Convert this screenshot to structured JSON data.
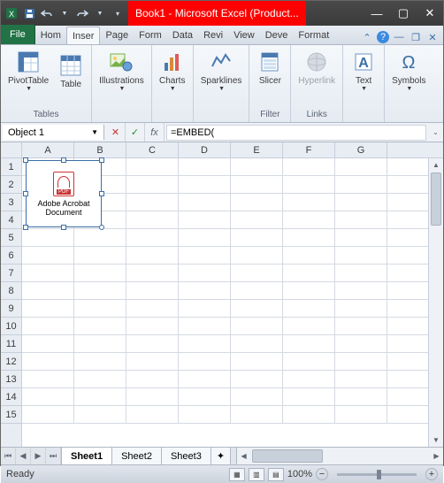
{
  "titlebar": {
    "title": "Book1 - Microsoft Excel (Product...",
    "qat": {
      "save": "save",
      "undo": "undo",
      "redo": "redo"
    }
  },
  "tabs": {
    "file": "File",
    "items": [
      "Hom",
      "Inser",
      "Page",
      "Form",
      "Data",
      "Revi",
      "View",
      "Deve",
      "Format"
    ],
    "active_index": 1
  },
  "ribbon": {
    "groups": [
      {
        "label": "Tables",
        "buttons": [
          {
            "name": "pivottable",
            "label": "PivotTable",
            "dd": true
          },
          {
            "name": "table",
            "label": "Table"
          }
        ]
      },
      {
        "label": "",
        "buttons": [
          {
            "name": "illustrations",
            "label": "Illustrations",
            "dd": true
          }
        ]
      },
      {
        "label": "",
        "buttons": [
          {
            "name": "charts",
            "label": "Charts",
            "dd": true
          }
        ]
      },
      {
        "label": "",
        "buttons": [
          {
            "name": "sparklines",
            "label": "Sparklines",
            "dd": true
          }
        ]
      },
      {
        "label": "Filter",
        "buttons": [
          {
            "name": "slicer",
            "label": "Slicer"
          }
        ]
      },
      {
        "label": "Links",
        "buttons": [
          {
            "name": "hyperlink",
            "label": "Hyperlink",
            "disabled": true
          }
        ]
      },
      {
        "label": "",
        "buttons": [
          {
            "name": "text",
            "label": "Text",
            "dd": true
          }
        ]
      },
      {
        "label": "",
        "buttons": [
          {
            "name": "symbols",
            "label": "Symbols",
            "dd": true
          }
        ]
      }
    ]
  },
  "formula_bar": {
    "name_box": "Object 1",
    "fx_label": "fx",
    "formula": "=EMBED("
  },
  "grid": {
    "columns": [
      "A",
      "B",
      "C",
      "D",
      "E",
      "F",
      "G"
    ],
    "rows": [
      "1",
      "2",
      "3",
      "4",
      "5",
      "6",
      "7",
      "8",
      "9",
      "10",
      "11",
      "12",
      "13",
      "14",
      "15"
    ]
  },
  "embedded_object": {
    "label_line1": "Adobe Acrobat",
    "label_line2": "Document",
    "badge": "PDF"
  },
  "sheet_tabs": {
    "items": [
      "Sheet1",
      "Sheet2",
      "Sheet3"
    ],
    "active_index": 0
  },
  "statusbar": {
    "left": "Ready",
    "zoom": "100%"
  }
}
